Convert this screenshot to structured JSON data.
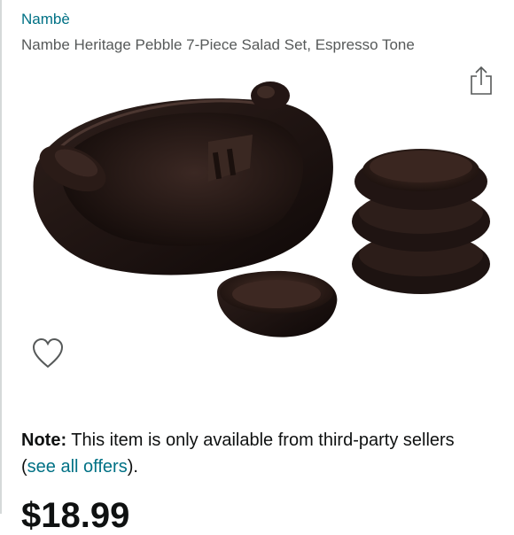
{
  "product": {
    "brand": "Nambè",
    "title": "Nambe Heritage Pebble 7-Piece Salad Set, Espresso Tone"
  },
  "icons": {
    "share": "share-icon",
    "wishlist": "heart-outline-icon"
  },
  "note": {
    "label": "Note:",
    "text_before": " This item is only available from third-party sellers (",
    "link": "see all offers",
    "text_after": ")."
  },
  "price": {
    "display": "$18.99"
  },
  "colors": {
    "link": "#007185",
    "secondary_text": "#565959",
    "wood": "#2a1b17"
  }
}
